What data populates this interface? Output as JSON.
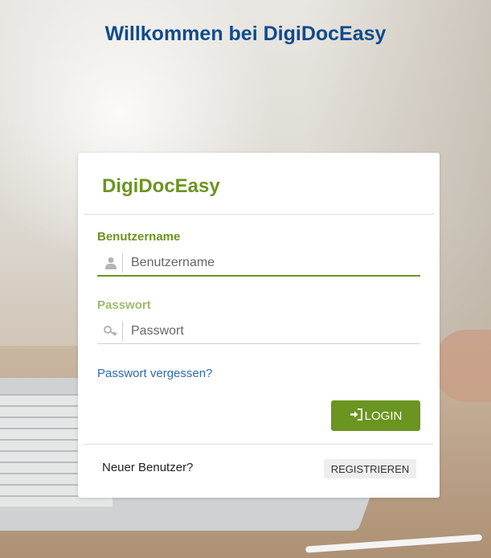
{
  "page": {
    "title": "Willkommen bei DigiDocEasy"
  },
  "card": {
    "brand": "DigiDocEasy",
    "username": {
      "label": "Benutzername",
      "placeholder": "Benutzername",
      "value": "",
      "icon": "user-icon"
    },
    "password": {
      "label": "Passwort",
      "placeholder": "Passwort",
      "value": "",
      "icon": "key-icon"
    },
    "forgot_link": "Passwort vergessen?",
    "login_button": {
      "label": "LOGIN",
      "icon": "login-icon"
    },
    "new_user_text": "Neuer Benutzer?",
    "register_button": "REGISTRIEREN"
  },
  "colors": {
    "accent": "#6a9520",
    "title": "#0e4b8c",
    "link": "#2d6bb0"
  }
}
